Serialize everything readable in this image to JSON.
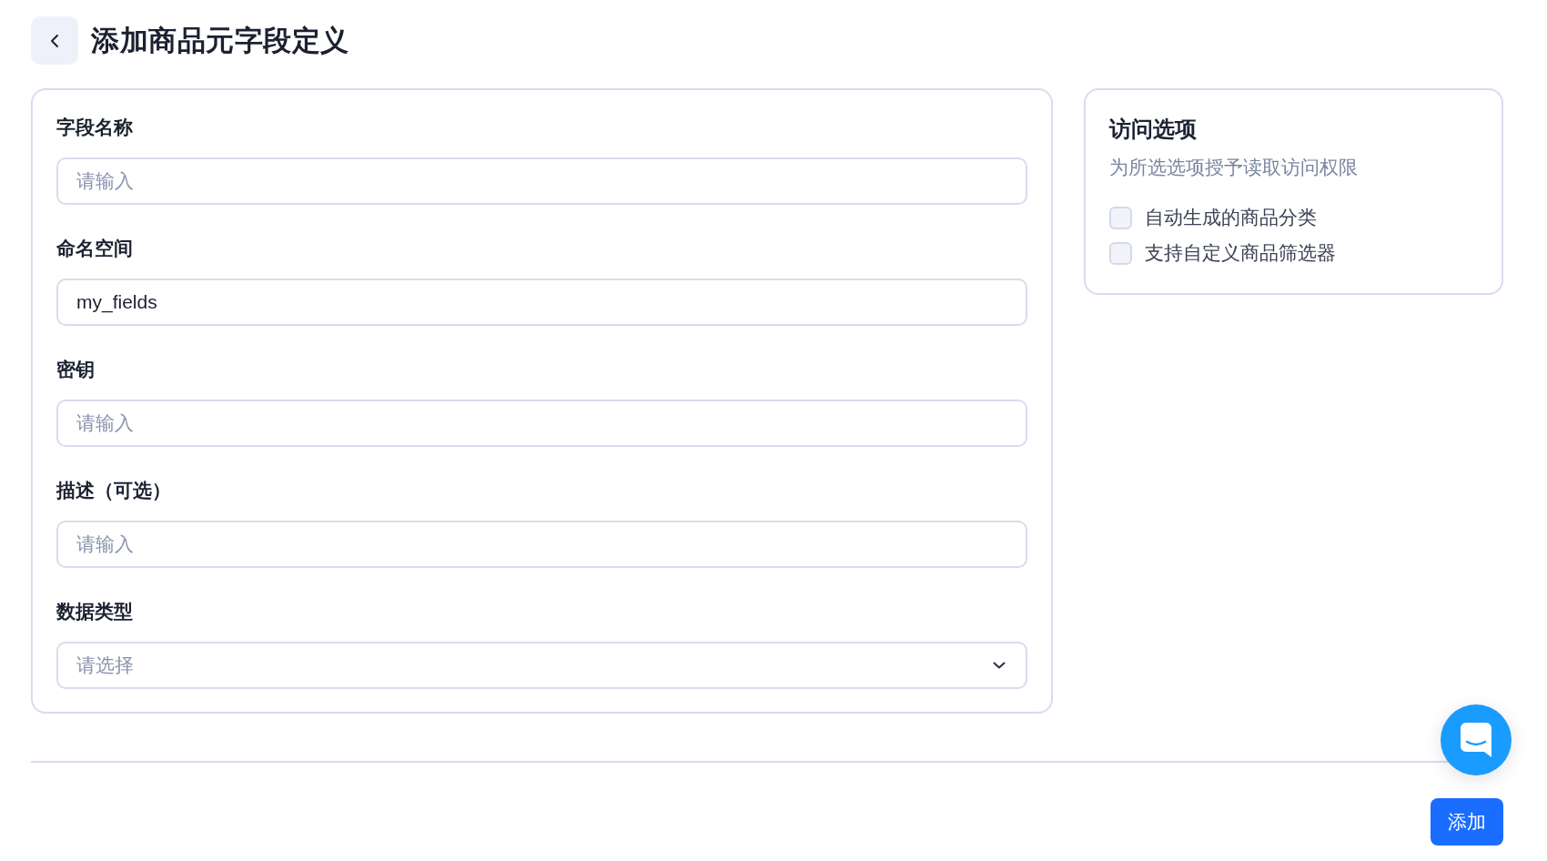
{
  "header": {
    "title": "添加商品元字段定义"
  },
  "form": {
    "fields": [
      {
        "kind": "input",
        "label": "字段名称",
        "placeholder": "请输入"
      },
      {
        "kind": "input",
        "label": "命名空间",
        "value": "my_fields"
      },
      {
        "kind": "input",
        "label": "密钥",
        "placeholder": "请输入"
      },
      {
        "kind": "input",
        "label": "描述（可选）",
        "placeholder": "请输入"
      },
      {
        "kind": "select",
        "label": "数据类型",
        "placeholder": "请选择"
      }
    ]
  },
  "access_options": {
    "title": "访问选项",
    "subtitle": "为所选选项授予读取访问权限",
    "options": [
      {
        "label": "自动生成的商品分类",
        "checked": false
      },
      {
        "label": "支持自定义商品筛选器",
        "checked": false
      }
    ]
  },
  "footer": {
    "submit_button": "添加"
  }
}
